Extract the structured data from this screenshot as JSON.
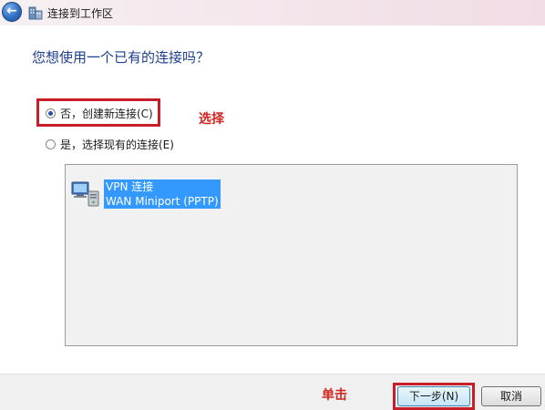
{
  "window": {
    "title": "连接到工作区",
    "back_glyph": "←",
    "back_icon": "back-arrow-icon",
    "app_icon": "network-building-icon"
  },
  "main": {
    "heading": "您想使用一个已有的连接吗？",
    "options": [
      {
        "label": "否，创建新连接(C)",
        "checked": true
      },
      {
        "label": "是，选择现有的连接(E)",
        "checked": false
      }
    ],
    "connection": {
      "name": "VPN 连接",
      "device": "WAN Miniport (PPTP)",
      "icon": "network-connection-icon",
      "selected": true
    }
  },
  "annotations": {
    "select_label": "选择",
    "click_label": "单击",
    "color": "#c81e2a"
  },
  "footer": {
    "next_label": "下一步(N)",
    "cancel_label": "取消"
  }
}
